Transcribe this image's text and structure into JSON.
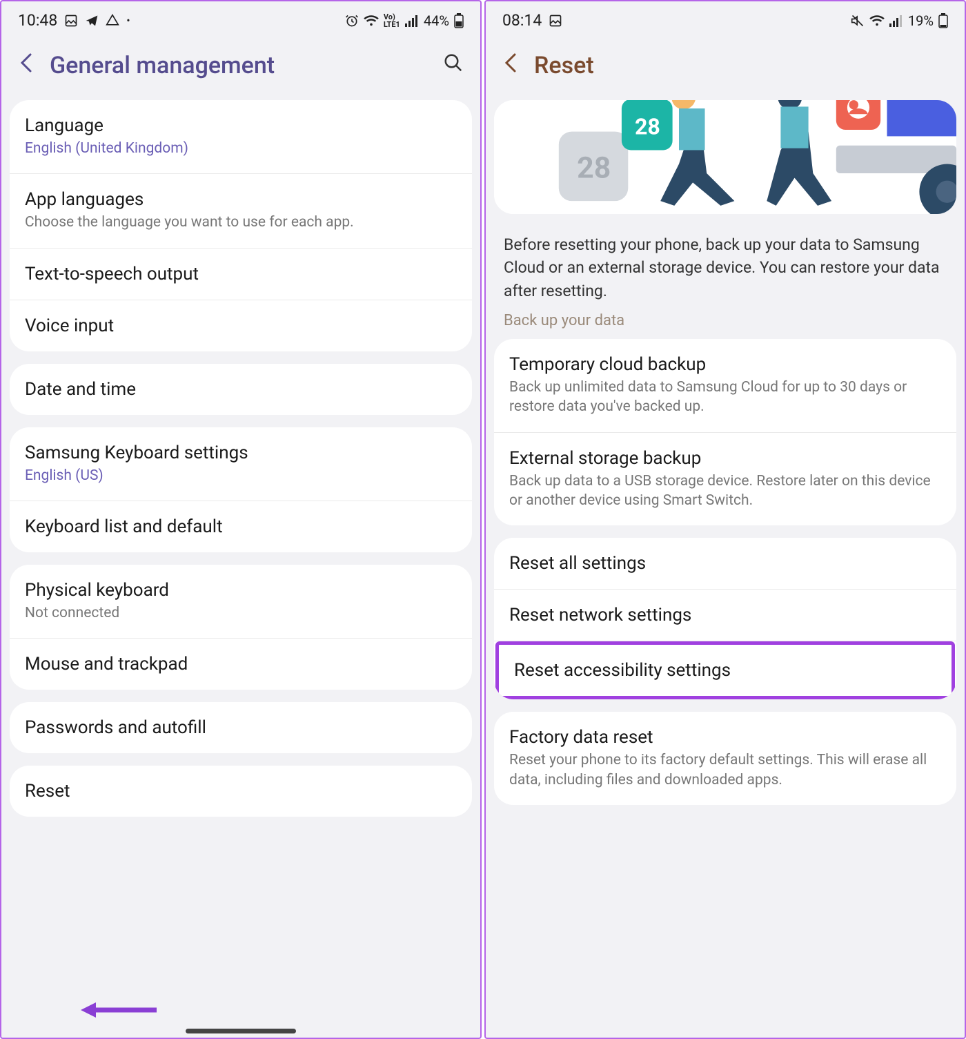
{
  "left": {
    "status": {
      "time": "10:48",
      "battery": "44%"
    },
    "title": "General management",
    "groups": [
      [
        {
          "title": "Language",
          "sub": "English (United Kingdom)",
          "accent": true
        },
        {
          "title": "App languages",
          "sub": "Choose the language you want to use for each app."
        },
        {
          "title": "Text-to-speech output"
        },
        {
          "title": "Voice input"
        }
      ],
      [
        {
          "title": "Date and time"
        }
      ],
      [
        {
          "title": "Samsung Keyboard settings",
          "sub": "English (US)",
          "accent": true
        },
        {
          "title": "Keyboard list and default"
        }
      ],
      [
        {
          "title": "Physical keyboard",
          "sub": "Not connected"
        },
        {
          "title": "Mouse and trackpad"
        }
      ],
      [
        {
          "title": "Passwords and autofill"
        }
      ],
      [
        {
          "title": "Reset"
        }
      ]
    ]
  },
  "right": {
    "status": {
      "time": "08:14",
      "battery": "19%"
    },
    "title": "Reset",
    "info": "Before resetting your phone, back up your data to Samsung Cloud or an external storage device. You can restore your data after resetting.",
    "section_label": "Back up your data",
    "backup_group": [
      {
        "title": "Temporary cloud backup",
        "sub": "Back up unlimited data to Samsung Cloud for up to 30 days or restore data you've backed up."
      },
      {
        "title": "External storage backup",
        "sub": "Back up data to a USB storage device. Restore later on this device or another device using Smart Switch."
      }
    ],
    "reset_group": [
      {
        "title": "Reset all settings"
      },
      {
        "title": "Reset network settings"
      },
      {
        "title": "Reset accessibility settings",
        "highlight": true
      }
    ],
    "factory_group": [
      {
        "title": "Factory data reset",
        "sub": "Reset your phone to its factory default settings. This will erase all data, including files and downloaded apps."
      }
    ]
  }
}
